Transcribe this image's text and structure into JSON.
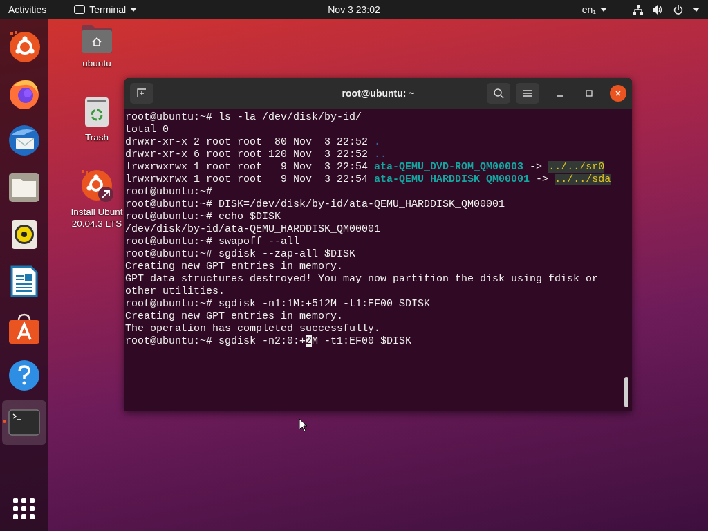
{
  "top_bar": {
    "activities": "Activities",
    "app_menu": "Terminal",
    "clock": "Nov 3  23:02",
    "keyboard_layout": "en₁"
  },
  "dock": {
    "items": [
      {
        "kind": "installer",
        "selected": false,
        "running": false
      },
      {
        "kind": "firefox",
        "selected": false,
        "running": false
      },
      {
        "kind": "thunderbird",
        "selected": false,
        "running": false
      },
      {
        "kind": "files",
        "selected": false,
        "running": false
      },
      {
        "kind": "rhythmbox",
        "selected": false,
        "running": false
      },
      {
        "kind": "writer",
        "selected": false,
        "running": false
      },
      {
        "kind": "software",
        "selected": false,
        "running": false
      },
      {
        "kind": "help",
        "selected": false,
        "running": false
      },
      {
        "kind": "terminal",
        "selected": true,
        "running": true
      }
    ]
  },
  "desktop_icons": [
    {
      "kind": "home",
      "label_lines": [
        "ubuntu"
      ]
    },
    {
      "kind": "trash",
      "label_lines": [
        "Trash"
      ]
    },
    {
      "kind": "installer",
      "label_lines": [
        "Install Ubunt",
        "20.04.3 LTS"
      ]
    }
  ],
  "window": {
    "title": "root@ubuntu: ~",
    "lines": [
      [
        {
          "kind": "plain",
          "text": "root@ubuntu:~# ls -la /dev/disk/by-id/"
        }
      ],
      [
        {
          "kind": "plain",
          "text": "total 0"
        }
      ],
      [
        {
          "kind": "plain",
          "text": "drwxr-xr-x 2 root root  80 Nov  3 22:52 "
        },
        {
          "kind": "dir",
          "text": "."
        }
      ],
      [
        {
          "kind": "plain",
          "text": "drwxr-xr-x 6 root root 120 Nov  3 22:52 "
        },
        {
          "kind": "dir",
          "text": ".."
        }
      ],
      [
        {
          "kind": "plain",
          "text": "lrwxrwxrwx 1 root root   9 Nov  3 22:54 "
        },
        {
          "kind": "link",
          "text": "ata-QEMU_DVD-ROM_QM00003"
        },
        {
          "kind": "plain",
          "text": " -> "
        },
        {
          "kind": "target",
          "text": "../../sr0"
        }
      ],
      [
        {
          "kind": "plain",
          "text": "lrwxrwxrwx 1 root root   9 Nov  3 22:54 "
        },
        {
          "kind": "link",
          "text": "ata-QEMU_HARDDISK_QM00001"
        },
        {
          "kind": "plain",
          "text": " -> "
        },
        {
          "kind": "target",
          "text": "../../sda"
        }
      ],
      [
        {
          "kind": "plain",
          "text": "root@ubuntu:~#"
        }
      ],
      [
        {
          "kind": "plain",
          "text": "root@ubuntu:~# DISK=/dev/disk/by-id/ata-QEMU_HARDDISK_QM00001"
        }
      ],
      [
        {
          "kind": "plain",
          "text": "root@ubuntu:~# echo $DISK"
        }
      ],
      [
        {
          "kind": "plain",
          "text": "/dev/disk/by-id/ata-QEMU_HARDDISK_QM00001"
        }
      ],
      [
        {
          "kind": "plain",
          "text": "root@ubuntu:~# swapoff --all"
        }
      ],
      [
        {
          "kind": "plain",
          "text": "root@ubuntu:~# sgdisk --zap-all $DISK"
        }
      ],
      [
        {
          "kind": "plain",
          "text": "Creating new GPT entries in memory."
        }
      ],
      [
        {
          "kind": "plain",
          "text": "GPT data structures destroyed! You may now partition the disk using fdisk or"
        }
      ],
      [
        {
          "kind": "plain",
          "text": "other utilities."
        }
      ],
      [
        {
          "kind": "plain",
          "text": "root@ubuntu:~# sgdisk -n1:1M:+512M -t1:EF00 $DISK"
        }
      ],
      [
        {
          "kind": "plain",
          "text": "Creating new GPT entries in memory."
        }
      ],
      [
        {
          "kind": "plain",
          "text": "The operation has completed successfully."
        }
      ],
      [
        {
          "kind": "plain",
          "text": "root@ubuntu:~# sgdisk -n2:0:+"
        },
        {
          "kind": "cursor",
          "text": "2"
        },
        {
          "kind": "plain",
          "text": "M -t1:EF00 $DISK"
        }
      ]
    ]
  }
}
